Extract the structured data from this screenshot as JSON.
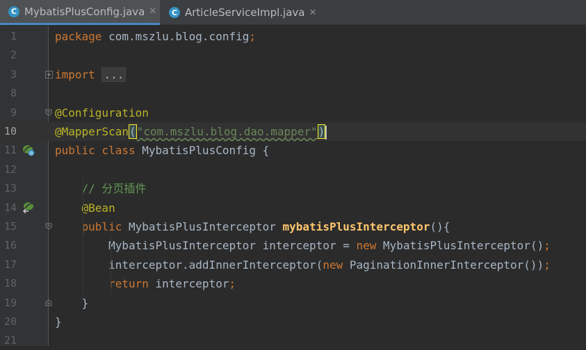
{
  "tabs": [
    {
      "label": "MybatisPlusConfig.java",
      "icon": "C",
      "active": true
    },
    {
      "label": "ArticleServiceImpl.java",
      "icon": "C",
      "active": false
    }
  ],
  "colors": {
    "keyword": "#cc7832",
    "annotation": "#bbb529",
    "string": "#6a8759",
    "comment": "#629755",
    "method": "#ffc66d",
    "text": "#a9b7c6"
  },
  "lines": [
    {
      "num": "1",
      "segments": [
        {
          "t": "package ",
          "c": "kw"
        },
        {
          "t": "com.mszlu.blog.config",
          "c": ""
        },
        {
          "t": ";",
          "c": "kw"
        }
      ]
    },
    {
      "num": "2",
      "segments": []
    },
    {
      "num": "3",
      "segments": [
        {
          "t": "import ",
          "c": "kw"
        },
        {
          "t": "...",
          "c": "fold-text"
        }
      ]
    },
    {
      "num": "8",
      "segments": []
    },
    {
      "num": "9",
      "segments": [
        {
          "t": "@Configuration",
          "c": "ann"
        }
      ]
    },
    {
      "num": "10",
      "segments": [
        {
          "t": "@MapperScan",
          "c": "ann"
        },
        {
          "t": "(",
          "c": "brace"
        },
        {
          "t": "\"com.mszlu.blog.dao.mapper\"",
          "c": "str wavy"
        },
        {
          "t": ")",
          "c": "brace"
        }
      ]
    },
    {
      "num": "11",
      "segments": [
        {
          "t": "public class ",
          "c": "kw"
        },
        {
          "t": "MybatisPlusConfig {",
          "c": ""
        }
      ]
    },
    {
      "num": "12",
      "segments": []
    },
    {
      "num": "13",
      "segments": [
        {
          "t": "    ",
          "c": ""
        },
        {
          "t": "// 分页插件",
          "c": "cmt"
        }
      ]
    },
    {
      "num": "14",
      "segments": [
        {
          "t": "    ",
          "c": ""
        },
        {
          "t": "@Bean",
          "c": "ann"
        }
      ]
    },
    {
      "num": "15",
      "segments": [
        {
          "t": "    ",
          "c": ""
        },
        {
          "t": "public ",
          "c": "kw"
        },
        {
          "t": "MybatisPlusInterceptor ",
          "c": ""
        },
        {
          "t": "mybatisPlusInterceptor",
          "c": "fn"
        },
        {
          "t": "(){",
          "c": ""
        }
      ]
    },
    {
      "num": "16",
      "segments": [
        {
          "t": "        MybatisPlusInterceptor interceptor = ",
          "c": ""
        },
        {
          "t": "new ",
          "c": "kw"
        },
        {
          "t": "MybatisPlusInterceptor()",
          "c": ""
        },
        {
          "t": ";",
          "c": "kw"
        }
      ]
    },
    {
      "num": "17",
      "segments": [
        {
          "t": "        interceptor.addInnerInterceptor(",
          "c": ""
        },
        {
          "t": "new ",
          "c": "kw"
        },
        {
          "t": "PaginationInnerInterceptor())",
          "c": ""
        },
        {
          "t": ";",
          "c": "kw"
        }
      ]
    },
    {
      "num": "18",
      "segments": [
        {
          "t": "        ",
          "c": ""
        },
        {
          "t": "return ",
          "c": "kw"
        },
        {
          "t": "interceptor",
          "c": ""
        },
        {
          "t": ";",
          "c": "kw"
        }
      ]
    },
    {
      "num": "19",
      "segments": [
        {
          "t": "    }",
          "c": ""
        }
      ]
    },
    {
      "num": "20",
      "segments": [
        {
          "t": "}",
          "c": ""
        }
      ]
    },
    {
      "num": "21",
      "segments": []
    }
  ]
}
